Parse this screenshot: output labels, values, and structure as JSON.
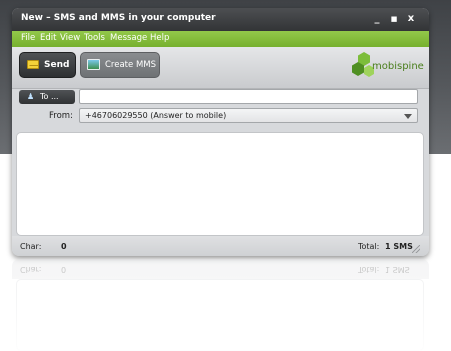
{
  "window": {
    "title": "New – SMS and MMS in your computer",
    "controls": [
      "_",
      "■",
      "x"
    ]
  },
  "menu": {
    "items": [
      "File",
      "Edit",
      "View",
      "Tools",
      "Message",
      "Help"
    ]
  },
  "toolbar": {
    "send_label": "Send",
    "send_icon": "envelope-icon",
    "create_mms_label": "Create MMS",
    "create_mms_icon": "picture-icon",
    "logo_text": "mobispine"
  },
  "compose": {
    "to_button_label": "To ...",
    "to_value": "",
    "from_label": "From:",
    "from_value": "+46706029550 (Answer to mobile)",
    "message_value": ""
  },
  "status": {
    "char_label": "Char:",
    "char_value": "0",
    "total_label": "Total:",
    "total_value": "1 SMS"
  },
  "colors": {
    "menu_green": "#7fb835",
    "logo_green": "#4a7e1c",
    "titlebar": "#3c3e41"
  }
}
